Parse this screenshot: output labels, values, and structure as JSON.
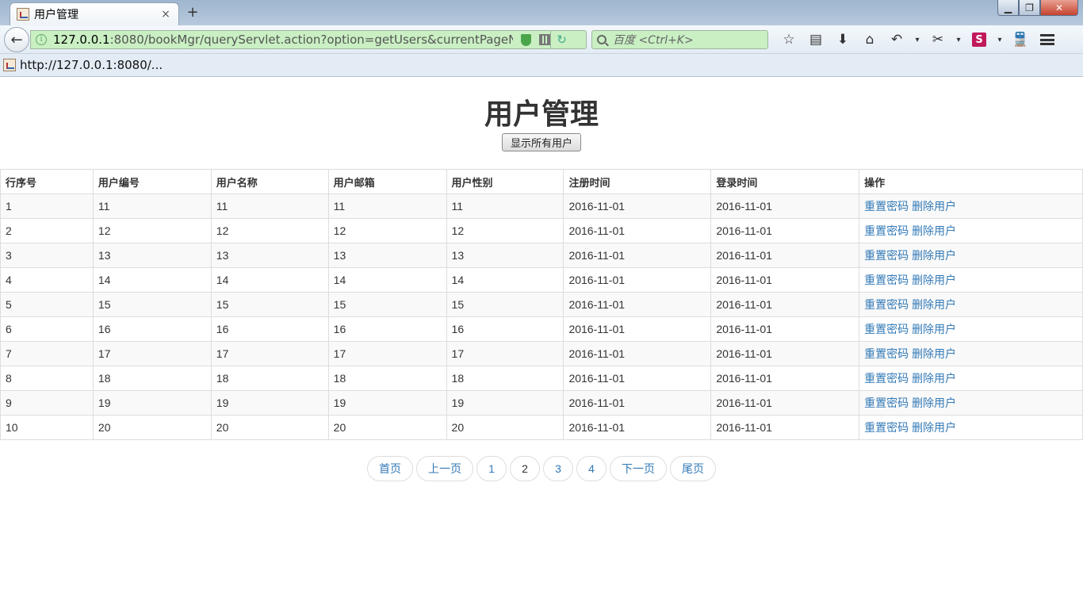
{
  "browser": {
    "tab_title": "用户管理",
    "tab_close": "×",
    "new_tab": "+",
    "url_host": "127.0.0.1",
    "url_rest": ":8080/bookMgr/queryServlet.action?option=getUsers&currentPageNu",
    "search_placeholder": "百度 <Ctrl+K>",
    "bookmark": "http://127.0.0.1:8080/..."
  },
  "page": {
    "title": "用户管理",
    "show_all_button": "显示所有用户"
  },
  "table": {
    "headers": [
      "行序号",
      "用户编号",
      "用户名称",
      "用户邮箱",
      "用户性别",
      "注册时间",
      "登录时间",
      "操作"
    ],
    "rows": [
      {
        "idx": "1",
        "id": "11",
        "name": "11",
        "email": "11",
        "gender": "11",
        "reg": "2016-11-01",
        "login": "2016-11-01"
      },
      {
        "idx": "2",
        "id": "12",
        "name": "12",
        "email": "12",
        "gender": "12",
        "reg": "2016-11-01",
        "login": "2016-11-01"
      },
      {
        "idx": "3",
        "id": "13",
        "name": "13",
        "email": "13",
        "gender": "13",
        "reg": "2016-11-01",
        "login": "2016-11-01"
      },
      {
        "idx": "4",
        "id": "14",
        "name": "14",
        "email": "14",
        "gender": "14",
        "reg": "2016-11-01",
        "login": "2016-11-01"
      },
      {
        "idx": "5",
        "id": "15",
        "name": "15",
        "email": "15",
        "gender": "15",
        "reg": "2016-11-01",
        "login": "2016-11-01"
      },
      {
        "idx": "6",
        "id": "16",
        "name": "16",
        "email": "16",
        "gender": "16",
        "reg": "2016-11-01",
        "login": "2016-11-01"
      },
      {
        "idx": "7",
        "id": "17",
        "name": "17",
        "email": "17",
        "gender": "17",
        "reg": "2016-11-01",
        "login": "2016-11-01"
      },
      {
        "idx": "8",
        "id": "18",
        "name": "18",
        "email": "18",
        "gender": "18",
        "reg": "2016-11-01",
        "login": "2016-11-01"
      },
      {
        "idx": "9",
        "id": "19",
        "name": "19",
        "email": "19",
        "gender": "19",
        "reg": "2016-11-01",
        "login": "2016-11-01"
      },
      {
        "idx": "10",
        "id": "20",
        "name": "20",
        "email": "20",
        "gender": "20",
        "reg": "2016-11-01",
        "login": "2016-11-01"
      }
    ],
    "action_reset": "重置密码",
    "action_delete": "删除用户"
  },
  "pagination": {
    "first": "首页",
    "prev": "上一页",
    "pages": [
      "1",
      "2",
      "3",
      "4"
    ],
    "current": "2",
    "next": "下一页",
    "last": "尾页"
  },
  "colors": {
    "link": "#337ab7",
    "urlbar_bg": "#c9efc3"
  }
}
